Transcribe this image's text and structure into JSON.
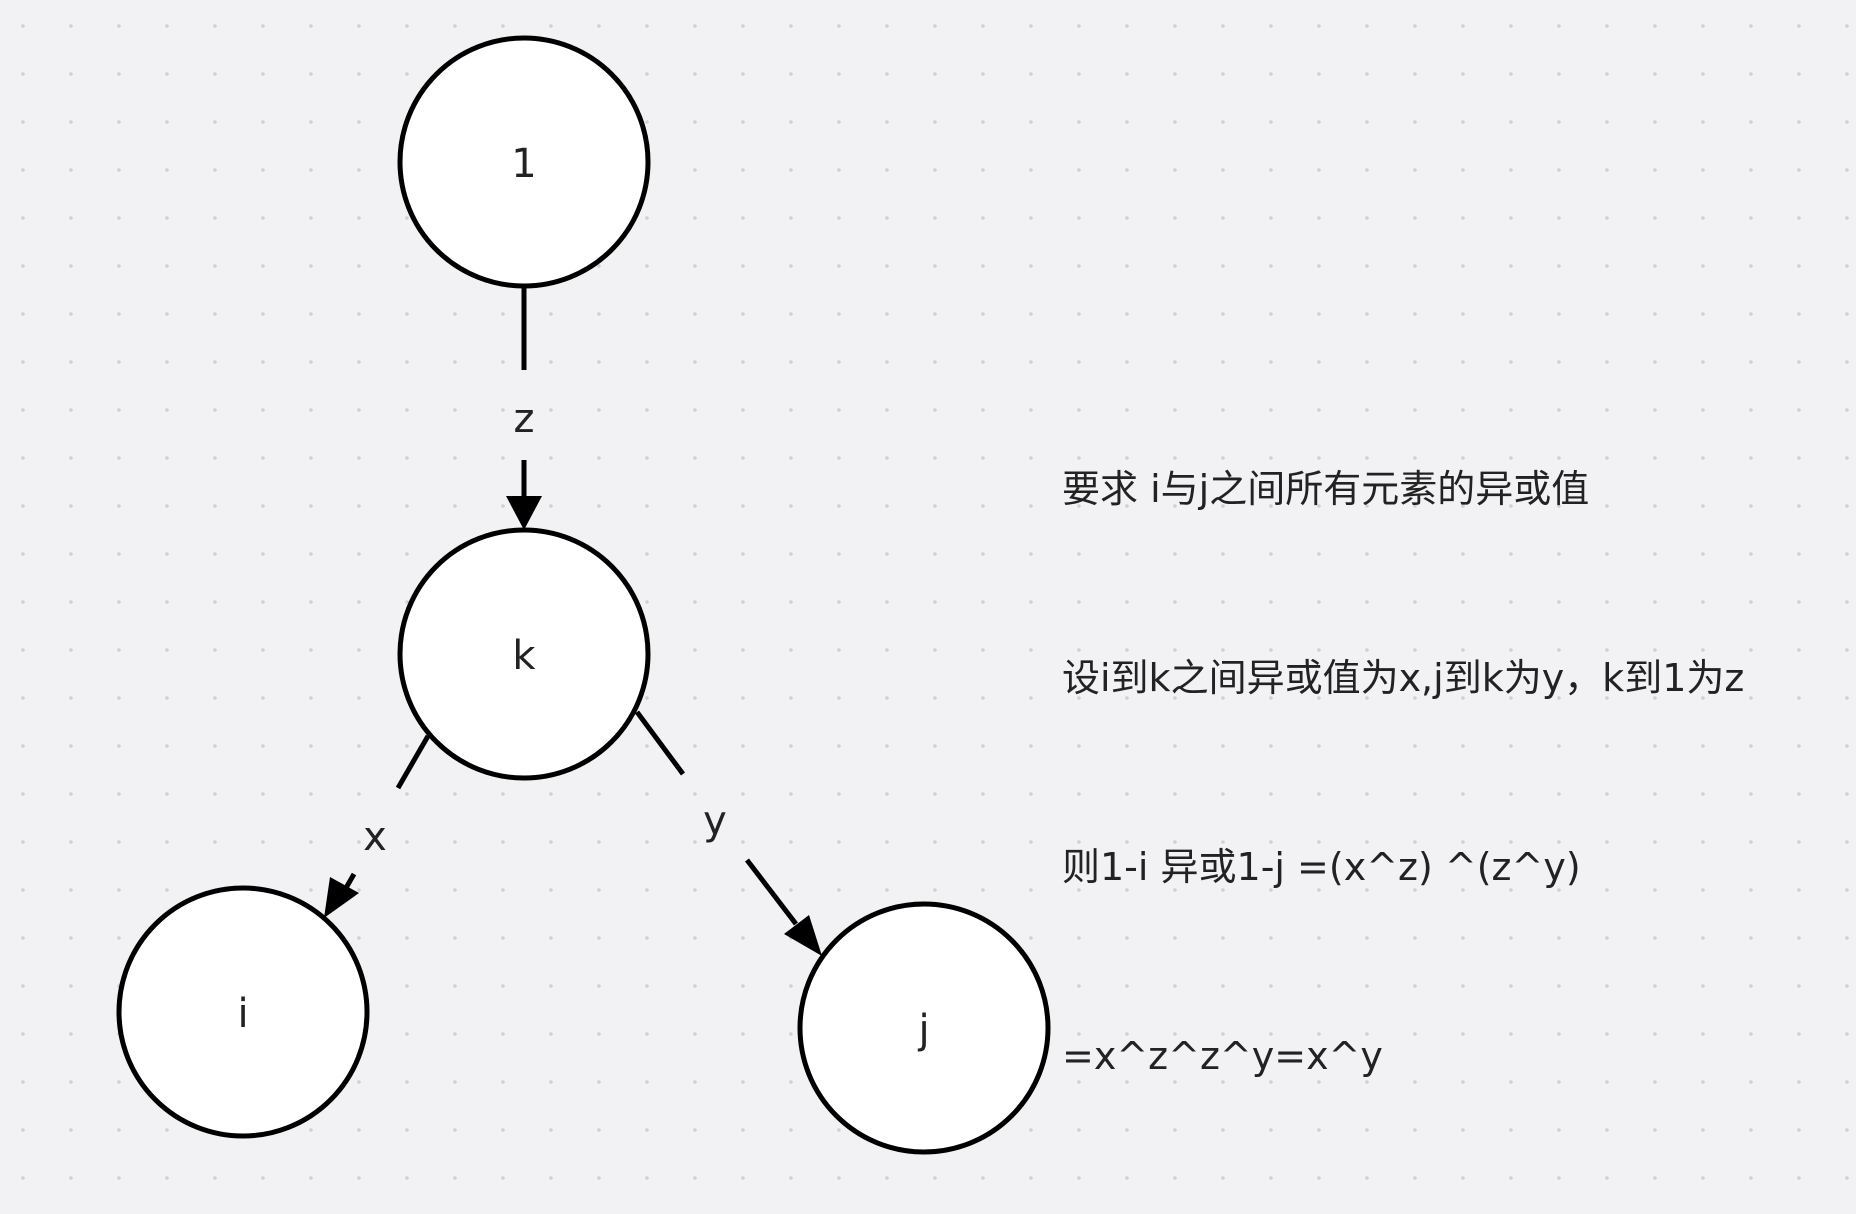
{
  "nodes": {
    "root": "1",
    "k": "k",
    "i": "i",
    "j": "j"
  },
  "edges": {
    "root_to_k": "z",
    "k_to_i": "x",
    "k_to_j": "y"
  },
  "note_lines": [
    "要求 i与j之间所有元素的异或值",
    "设i到k之间异或值为x,j到k为y，k到1为z",
    "则1-i 异或1-j =(x^z) ^(z^y)",
    "=x^z^z^y=x^y"
  ]
}
